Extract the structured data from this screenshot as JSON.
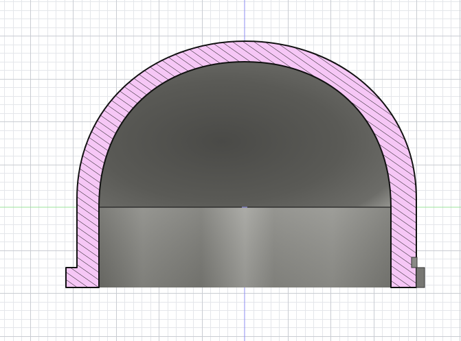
{
  "viewport": {
    "background": "#ffffff",
    "grid_minor_color": "#e4e6ea",
    "grid_major_color": "#c9ccd2",
    "axis_x_color": "#9be39b",
    "axis_y_color": "#8c8cf0"
  },
  "section_view": {
    "hatch_fill_color": "#f6c7f6",
    "hatch_line_color": "#1a1a1a",
    "outline_color": "#111111",
    "interior_dark_color": "#4a4a47",
    "interior_mid_color": "#6c6c68",
    "interior_light_color": "#9c9c97"
  },
  "icons": {
    "origin": "origin-crosshair-icon"
  }
}
